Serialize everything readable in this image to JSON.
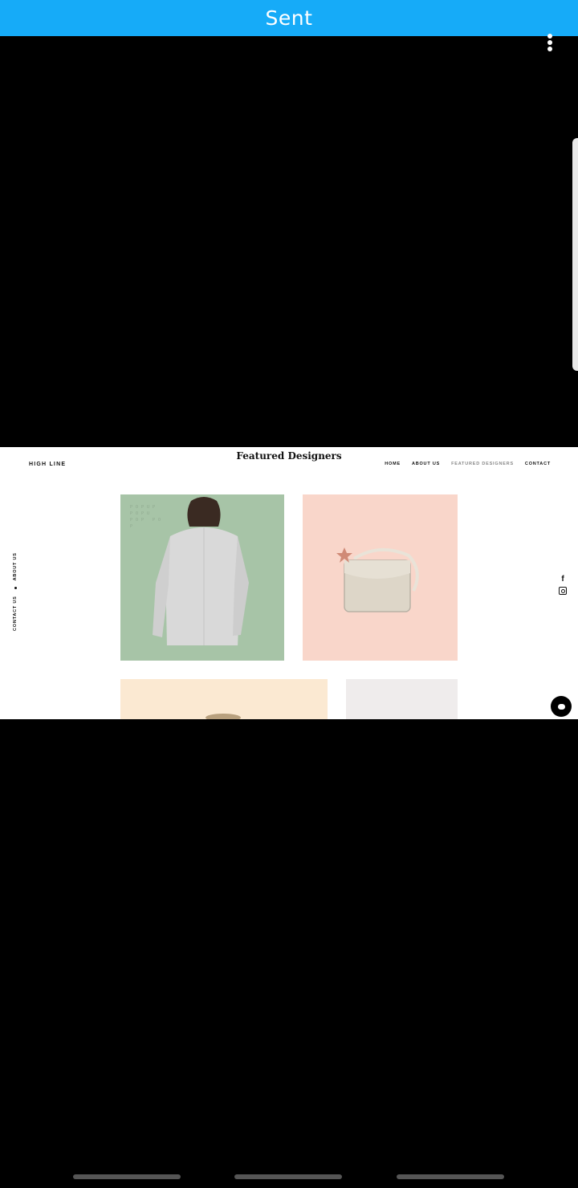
{
  "header": {
    "title": "Sent"
  },
  "website": {
    "logo": "HIGH LINE",
    "page_title": "Featured Designers",
    "nav": [
      "HOME",
      "ABOUT US",
      "FEATURED DESIGNERS",
      "CONTACT"
    ],
    "vertical_nav": [
      "CONTACT US",
      "ABOUT US"
    ],
    "tile_pattern_text": "POPUP POPU POP PO P"
  },
  "colors": {
    "header_bg": "#16abf8",
    "tile_green": "#a7c4a7",
    "tile_pink": "#f9d6ca",
    "tile_cream": "#fbe9d2",
    "tile_grey": "#efecec"
  },
  "icons": [
    "more-options-icon",
    "facebook-icon",
    "instagram-icon",
    "chat-icon"
  ]
}
